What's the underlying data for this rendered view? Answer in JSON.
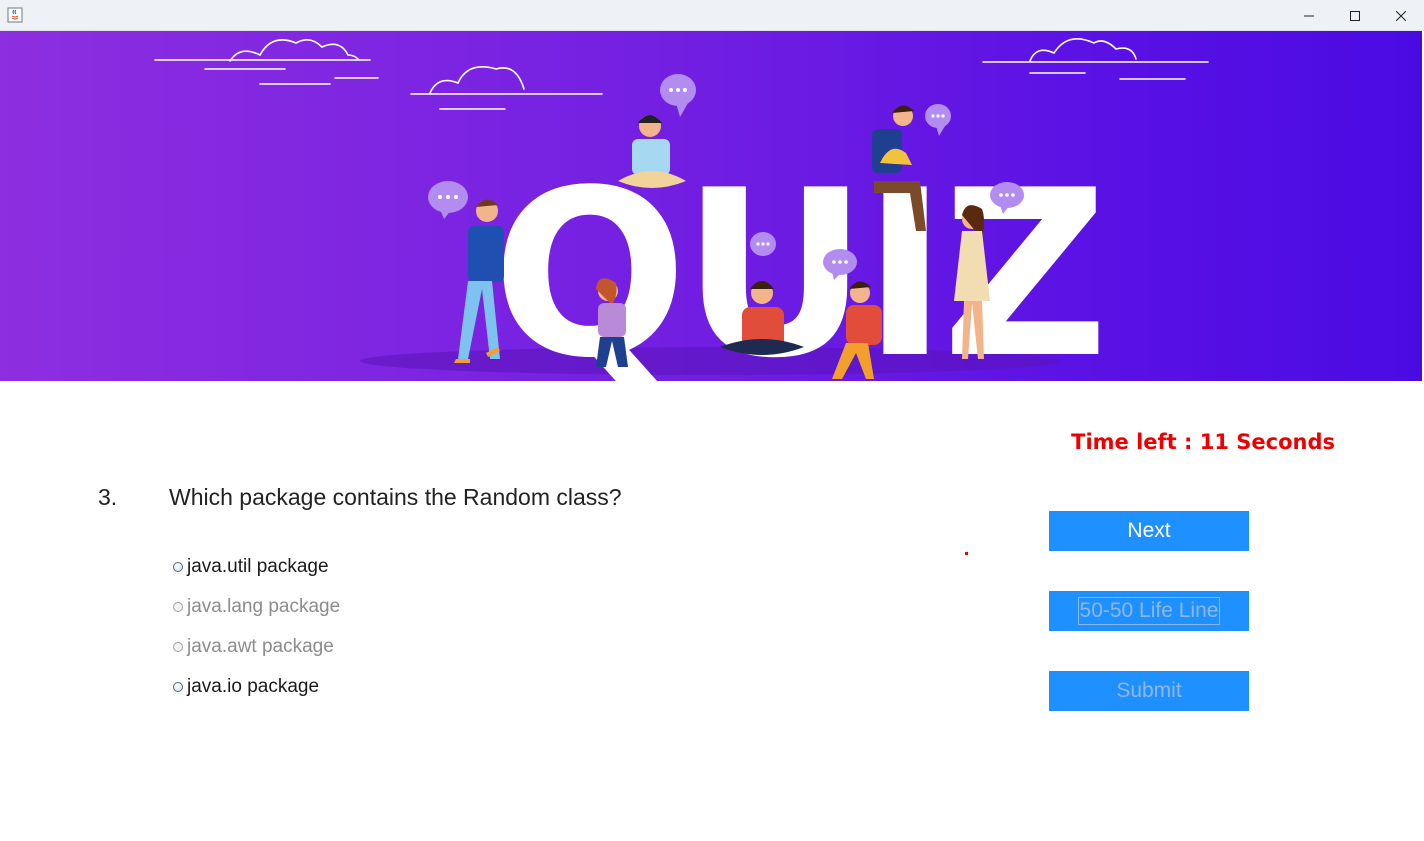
{
  "window": {
    "icons": {
      "app": "java-app-icon",
      "minimize": "minimize-icon",
      "maximize": "maximize-icon",
      "close": "close-icon"
    }
  },
  "banner": {
    "title": "QUIZ",
    "gradient_colors": [
      "#8d2ee0",
      "#4a0be3"
    ]
  },
  "timer": {
    "text": "Time left : 11 Seconds",
    "color": "#ee0000"
  },
  "question": {
    "number": "3.",
    "text": "Which package contains the Random class?"
  },
  "options": [
    {
      "label": "java.util package",
      "enabled": true,
      "selected": false
    },
    {
      "label": "java.lang package",
      "enabled": false,
      "selected": false
    },
    {
      "label": "java.awt package",
      "enabled": false,
      "selected": false
    },
    {
      "label": "java.io package",
      "enabled": true,
      "selected": false
    }
  ],
  "buttons": {
    "next": {
      "label": "Next",
      "enabled": true
    },
    "lifeline": {
      "label": "50-50 Life Line",
      "enabled": false
    },
    "submit": {
      "label": "Submit",
      "enabled": false
    },
    "color": "#1e90ff"
  }
}
